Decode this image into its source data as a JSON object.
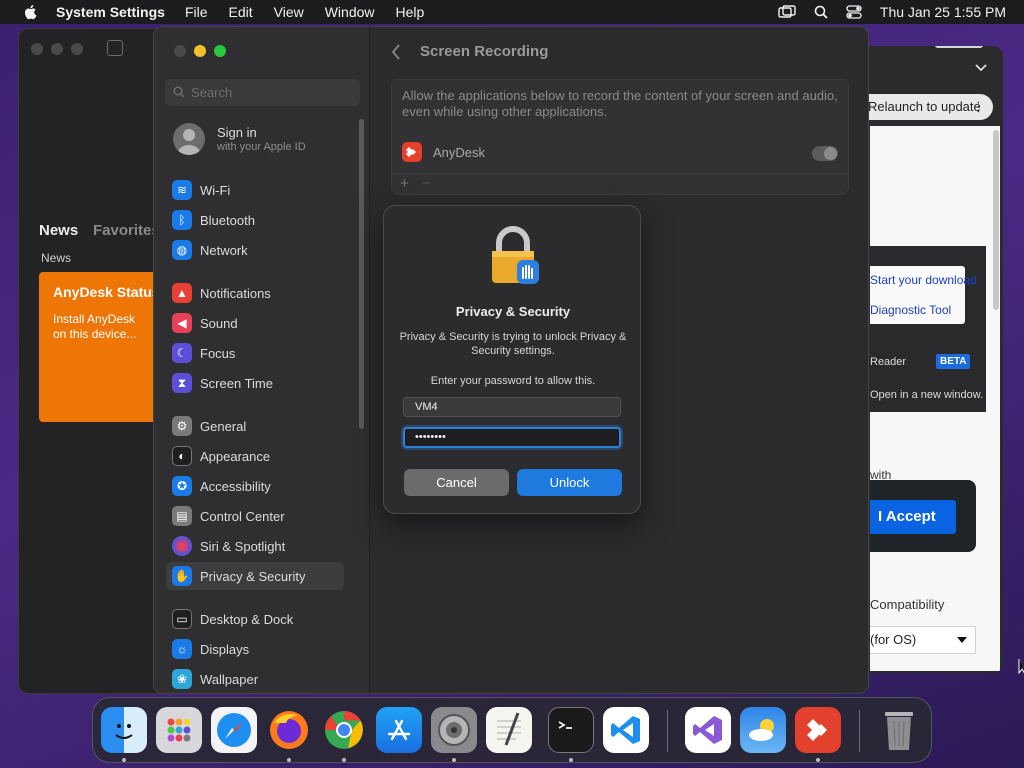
{
  "menubar": {
    "app_name": "System Settings",
    "menus": [
      "File",
      "Edit",
      "View",
      "Window",
      "Help"
    ],
    "clock": "Thu Jan 25  1:55 PM"
  },
  "news_window": {
    "tab_news": "News",
    "tab_favorites": "Favorites",
    "section": "News",
    "card_title": "AnyDesk Status",
    "card_body": "Install AnyDesk on this device..."
  },
  "browser_window": {
    "relaunch": "Relaunch to update",
    "download_link": "Start your download",
    "tool_link": "Diagnostic Tool",
    "reader": "Reader",
    "beta": "BETA",
    "new_window": "Open in a new window.",
    "with_text": "with",
    "accept": "I Accept",
    "compat": "Compatibility",
    "os_select": "(for OS)"
  },
  "settings": {
    "search_placeholder": "Search",
    "signin_title": "Sign in",
    "signin_sub": "with your Apple ID",
    "nav_items": [
      {
        "label": "Wi-Fi",
        "color": "#1a7ae8"
      },
      {
        "label": "Bluetooth",
        "color": "#1a7ae8"
      },
      {
        "label": "Network",
        "color": "#1a7ae8"
      },
      {
        "label": "Notifications",
        "color": "#e84034"
      },
      {
        "label": "Sound",
        "color": "#e84058"
      },
      {
        "label": "Focus",
        "color": "#5a4fd6"
      },
      {
        "label": "Screen Time",
        "color": "#5a4fd6"
      },
      {
        "label": "General",
        "color": "#7a7a7c"
      },
      {
        "label": "Appearance",
        "color": "#1f1f1f"
      },
      {
        "label": "Accessibility",
        "color": "#1a7ae8"
      },
      {
        "label": "Control Center",
        "color": "#7a7a7c"
      },
      {
        "label": "Siri & Spotlight",
        "color": "#b04fd6"
      },
      {
        "label": "Privacy & Security",
        "color": "#1a7ae8"
      },
      {
        "label": "Desktop & Dock",
        "color": "#1f1f1f"
      },
      {
        "label": "Displays",
        "color": "#1a7ae8"
      },
      {
        "label": "Wallpaper",
        "color": "#2fa6d8"
      }
    ],
    "page_title": "Screen Recording",
    "description": "Allow the applications below to record the content of your screen and audio, even while using other applications.",
    "app_name": "AnyDesk",
    "add": "+",
    "remove": "−"
  },
  "dialog": {
    "title": "Privacy & Security",
    "message": "Privacy & Security is trying to unlock Privacy & Security settings.",
    "prompt": "Enter your password to allow this.",
    "username": "VM4",
    "password_mask": "••••••••",
    "cancel": "Cancel",
    "unlock": "Unlock"
  },
  "dock": {
    "apps": [
      "Finder",
      "Launchpad",
      "Safari",
      "Firefox",
      "Chrome",
      "App Store",
      "System Settings",
      "TextEdit",
      "Terminal",
      "Visual Studio Code",
      "Visual Studio",
      "Weather",
      "AnyDesk",
      "Trash"
    ]
  }
}
